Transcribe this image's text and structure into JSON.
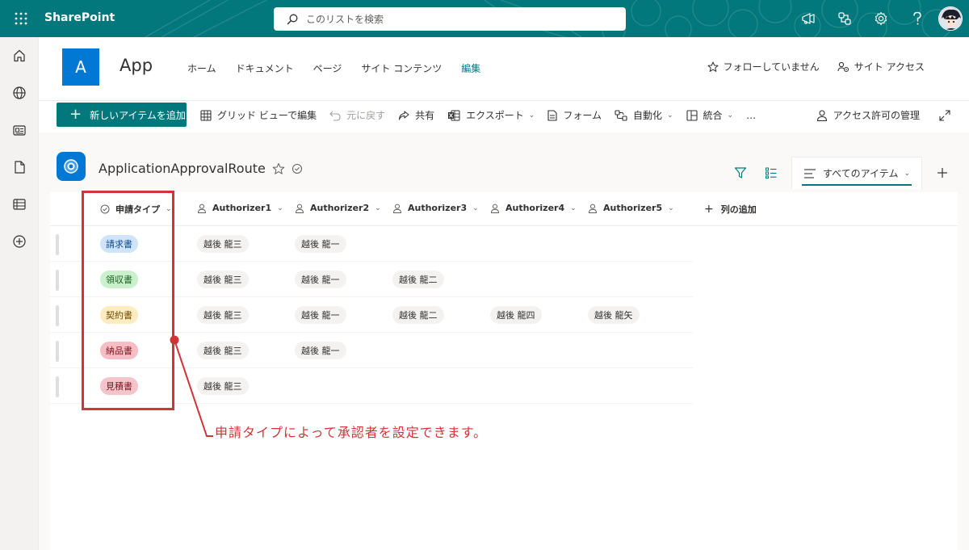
{
  "suite": {
    "app_name": "SharePoint",
    "search_placeholder": "このリストを検索"
  },
  "site": {
    "logo_letter": "A",
    "title": "App",
    "nav": [
      "ホーム",
      "ドキュメント",
      "ページ",
      "サイト コンテンツ",
      "編集"
    ],
    "follow_label": "フォローしていません",
    "site_access_label": "サイト アクセス"
  },
  "commandbar": {
    "new_item": "新しいアイテムを追加",
    "grid_edit": "グリッド ビューで編集",
    "undo": "元に戻す",
    "share": "共有",
    "export": "エクスポート",
    "forms": "フォーム",
    "automate": "自動化",
    "integrate": "統合",
    "more": "…",
    "manage_access": "アクセス許可の管理"
  },
  "list": {
    "title": "ApplicationApprovalRoute",
    "view_name": "すべてのアイテム",
    "columns": [
      "申請タイプ",
      "Authorizer1",
      "Authorizer2",
      "Authorizer3",
      "Authorizer4",
      "Authorizer5"
    ],
    "add_column": "列の追加",
    "rows": [
      {
        "type": "請求書",
        "authorizers": [
          "越後 龍三",
          "越後 龍一",
          "",
          "",
          ""
        ]
      },
      {
        "type": "領収書",
        "authorizers": [
          "越後 龍三",
          "越後 龍一",
          "越後 龍二",
          "",
          ""
        ]
      },
      {
        "type": "契約書",
        "authorizers": [
          "越後 龍三",
          "越後 龍一",
          "越後 龍二",
          "越後 龍四",
          "越後 龍矢"
        ]
      },
      {
        "type": "納品書",
        "authorizers": [
          "越後 龍三",
          "越後 龍一",
          "",
          "",
          ""
        ]
      },
      {
        "type": "見積書",
        "authorizers": [
          "越後 龍三",
          "",
          "",
          "",
          ""
        ]
      }
    ]
  },
  "tag_colors": {
    "請求書": {
      "bg": "#cfe4fa",
      "fg": "#0b4a8b"
    },
    "領収書": {
      "bg": "#caf0cc",
      "fg": "#1a5e20"
    },
    "契約書": {
      "bg": "#ffebc0",
      "fg": "#6b4a00"
    },
    "納品書": {
      "bg": "#f6bec4",
      "fg": "#7a1420"
    },
    "見積書": {
      "bg": "#f3c4c9",
      "fg": "#7a1420"
    }
  },
  "annotation": {
    "text": "申請タイプによって承認者を設定できます。",
    "color": "#d13438"
  },
  "theme": {
    "accent": "#03787c",
    "site_logo": "#0078d4"
  }
}
